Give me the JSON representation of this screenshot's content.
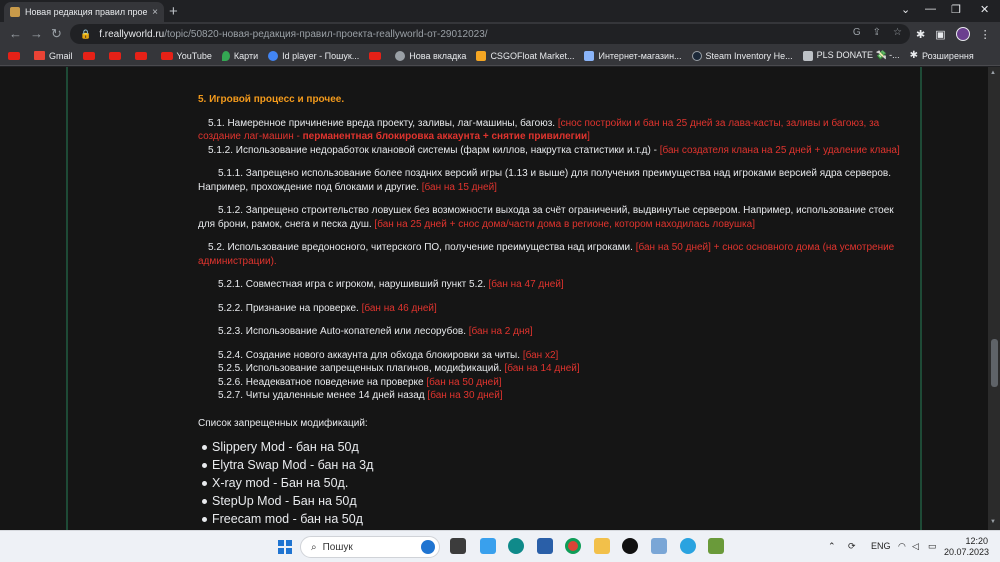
{
  "browser": {
    "tab_title": "Новая редакция правил прое",
    "tab_close": "×",
    "new_tab": "+",
    "window_controls": [
      "⌄",
      "—",
      "❐",
      "✕"
    ],
    "url_domain": "f.reallyworld.ru",
    "url_path": "/topic/50820-новая-редакция-правил-проекта-reallyworld-от-29012023/",
    "bookmarks": [
      {
        "label": "",
        "icon": "youtube-icon"
      },
      {
        "label": "Gmail",
        "icon": "gmail-icon"
      },
      {
        "label": "",
        "icon": "youtube-icon"
      },
      {
        "label": "",
        "icon": "youtube-icon"
      },
      {
        "label": "",
        "icon": "youtube-icon"
      },
      {
        "label": "YouTube",
        "icon": "youtube-icon"
      },
      {
        "label": "Карти",
        "icon": "maps-icon"
      },
      {
        "label": "Id player - Пошук...",
        "icon": "google-icon"
      },
      {
        "label": "",
        "icon": "youtube-icon"
      },
      {
        "label": "Нова вкладка",
        "icon": "globe-icon"
      },
      {
        "label": "CSGOFloat Market...",
        "icon": "csgofloat-icon"
      },
      {
        "label": "Интернет-магазин...",
        "icon": "shop-icon"
      },
      {
        "label": "Steam Inventory He...",
        "icon": "steam-icon"
      },
      {
        "label": "PLS DONATE 💸 -...",
        "icon": "pls-donate-icon"
      },
      {
        "label": "Розширення",
        "icon": "extensions-icon"
      }
    ]
  },
  "rules": {
    "section_title": "5. Игровой процесс и прочее.",
    "r5_1_text": "5.1. Намеренное причинение вреда проекту, заливы, лаг-машины, багоюз.",
    "r5_1_pen": "[снос постройки и бан на 25 дней за лава-касты, заливы и багоюз, за создание лаг-машин -",
    "r5_1_pen_bold": "перманентная блокировка аккаунта + снятие привилегии",
    "r5_1_pen_end": "]",
    "r5_1_2_text": "5.1.2. Использование недоработок клановой системы (фарм киллов, накрутка статистики и.т.д) -",
    "r5_1_2_pen": "[бан создателя клана на 25 дней + удаление клана]",
    "r5_1_1_text": "5.1.1. Запрещено использование более поздних версий игры (1.13 и выше) для получения преимущества над игроками версией ядра серверов. Например, прохождение под блоками и другие.",
    "r5_1_1_pen": "[бан на 15 дней]",
    "r5_1_2b_text": "5.1.2. Запрещено строительство ловушек без возможности выхода за счёт ограничений, выдвинутые сервером. Например, использование стоек для брони, рамок, снега и песка душ.",
    "r5_1_2b_pen": "[бан на 25 дней + снос дома/части дома в регионе, котором находилась ловушка]",
    "r5_2_text": "5.2. Использование вредоносного, читерского ПО, получение преимущества над игроками.",
    "r5_2_pen": "[бан на 50 дней] + снос основного дома (на усмотрение администрации).",
    "r5_2_1_text": "5.2.1. Совместная игра с игроком, нарушивший пункт 5.2.",
    "r5_2_1_pen": "[бан на 47  дней]",
    "r5_2_2_text": "5.2.2. Признание на проверке.",
    "r5_2_2_pen": "[бан на 46 дней]",
    "r5_2_3_text": "5.2.3. Использование Auto-копателей или лесорубов.",
    "r5_2_3_pen": "[бан на 2 дня]",
    "r5_2_4_text": "5.2.4. Создание нового аккаунта для обхода блокировки за читы.",
    "r5_2_4_pen": "[бан х2]",
    "r5_2_5_text": "5.2.5. Использование запрещенных плагинов, модификаций.",
    "r5_2_5_pen": "[бан на 14  дней]",
    "r5_2_6_text": "5.2.6. Неадекватное поведение на проверке",
    "r5_2_6_pen": "[бан на 50  дней]",
    "r5_2_7_text": "5.2.7. Читы удаленные менее 14 дней назад",
    "r5_2_7_pen": "[бан на 30  дней]",
    "mods_title": "Список запрещенных модификаций:",
    "mods": [
      "Slippery Mod - бан на 50д",
      "Elytra Swap Mod - бан на 3д",
      "X-ray mod - Бан на 50д.",
      "StepUp Mod - Бан на 50д",
      "Freecam mod - бан на 50д"
    ]
  },
  "taskbar": {
    "search_label": "Пошук",
    "lang": "ENG",
    "time": "12:20",
    "date": "20.07.2023"
  },
  "colors": {
    "accent_orange": "#f39a1c",
    "penalty_red": "#e0342e",
    "page_bg": "#151515"
  }
}
